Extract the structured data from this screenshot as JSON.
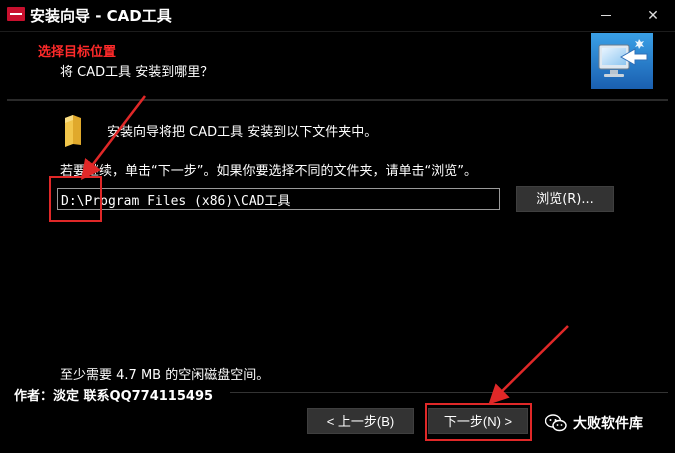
{
  "window": {
    "title": "安装向导 - CAD工具",
    "minimize_label": "",
    "close_label": "✕"
  },
  "header": {
    "annotation": "选择目标位置",
    "subtitle": "将 CAD工具 安装到哪里？",
    "image_icon": "computer-install-icon"
  },
  "body": {
    "folder_icon": "folder-icon",
    "instruction": "安装向导将把 CAD工具 安装到以下文件夹中。",
    "continue_text": "若要继续，单击“下一步”。如果你要选择不同的文件夹，请单击“浏览”。",
    "path_value": "D:\\Program Files (x86)\\CAD工具",
    "browse_label": "浏览(R)..."
  },
  "footer": {
    "disk_space": "至少需要 4.7 MB 的空闲磁盘空间。",
    "author": "作者：淡定  联系QQ774115495",
    "back_label": "< 上一步(B)",
    "next_label": "下一步(N) >"
  },
  "watermark": {
    "icon": "wechat-icon",
    "text": "大败软件库"
  },
  "colors": {
    "annotation_red": "#e02828",
    "background": "#000000",
    "button_bg": "#333333"
  }
}
